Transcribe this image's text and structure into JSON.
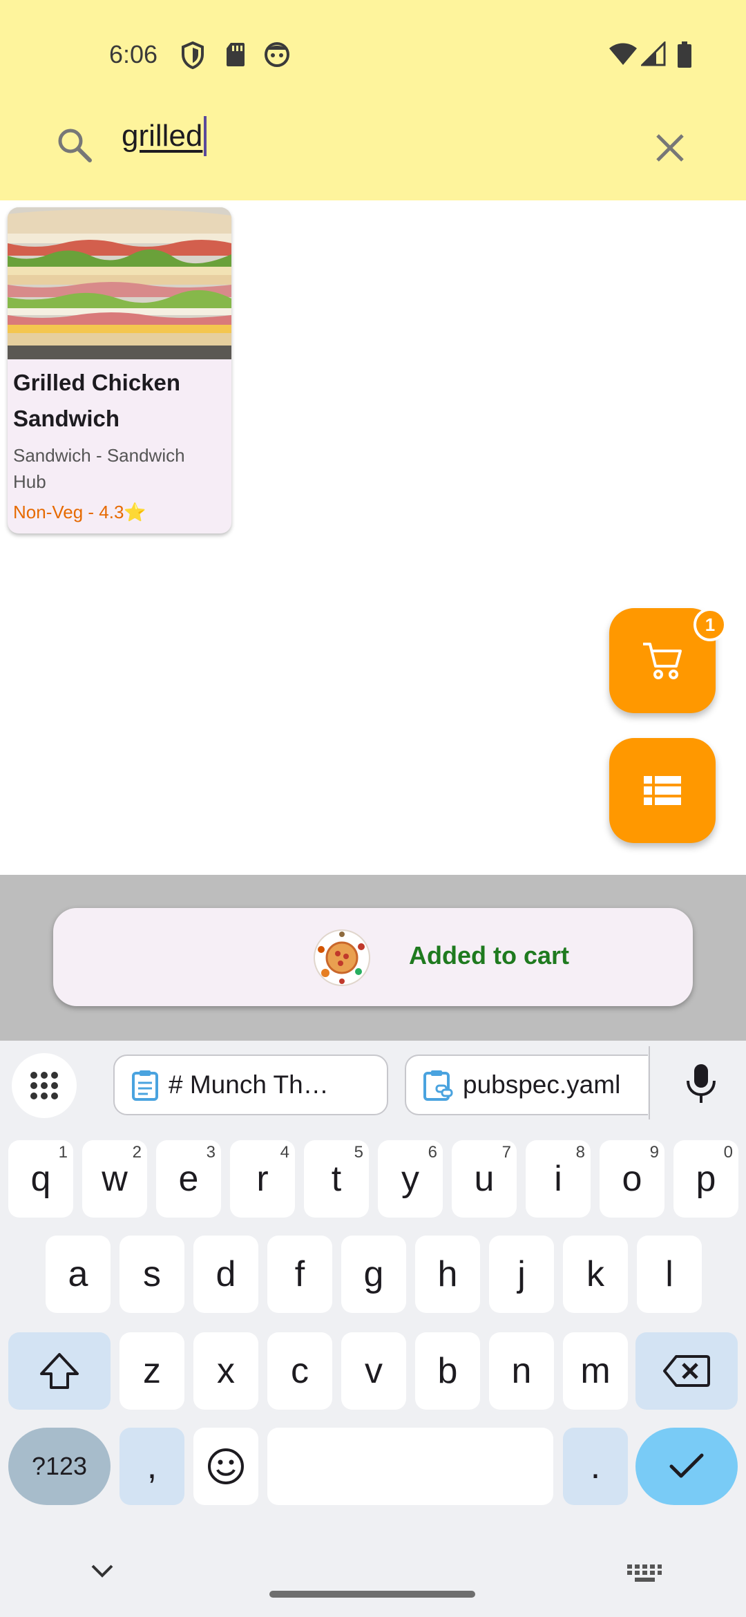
{
  "status_bar": {
    "time": "6:06"
  },
  "search": {
    "value": "grilled"
  },
  "results": [
    {
      "title": "Grilled Chicken Sandwich",
      "subtitle": "Sandwich - Sandwich Hub",
      "meta": "Non-Veg - 4.3⭐"
    }
  ],
  "cart": {
    "badge_count": "1"
  },
  "snackbar": {
    "message": "Added to cart"
  },
  "keyboard": {
    "clipboard_chips": [
      "# Munch  Th…",
      "pubspec.yaml"
    ],
    "row1": [
      {
        "key": "q",
        "hint": "1"
      },
      {
        "key": "w",
        "hint": "2"
      },
      {
        "key": "e",
        "hint": "3"
      },
      {
        "key": "r",
        "hint": "4"
      },
      {
        "key": "t",
        "hint": "5"
      },
      {
        "key": "y",
        "hint": "6"
      },
      {
        "key": "u",
        "hint": "7"
      },
      {
        "key": "i",
        "hint": "8"
      },
      {
        "key": "o",
        "hint": "9"
      },
      {
        "key": "p",
        "hint": "0"
      }
    ],
    "row2": [
      "a",
      "s",
      "d",
      "f",
      "g",
      "h",
      "j",
      "k",
      "l"
    ],
    "row3": [
      "z",
      "x",
      "c",
      "v",
      "b",
      "n",
      "m"
    ],
    "symbols_label": "?123",
    "comma": ",",
    "period": "."
  },
  "colors": {
    "header": "#fef49c",
    "accent": "#ff9800",
    "snackbar_text": "#1f7a1f",
    "rating_text": "#e66a00"
  }
}
